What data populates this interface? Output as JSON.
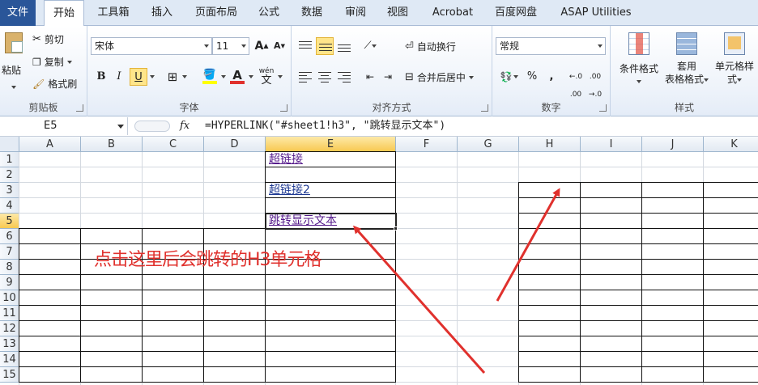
{
  "tabs": [
    "文件",
    "开始",
    "工具箱",
    "插入",
    "页面布局",
    "公式",
    "数据",
    "审阅",
    "视图",
    "Acrobat",
    "百度网盘",
    "ASAP Utilities"
  ],
  "clipboard": {
    "paste": "粘贴",
    "cut": "剪切",
    "copy": "复制",
    "format_painter": "格式刷",
    "label": "剪贴板"
  },
  "font": {
    "name": "宋体",
    "size": "11",
    "grow": "A",
    "shrink": "A",
    "wen": "wén",
    "bold": "B",
    "italic": "I",
    "underline": "U",
    "color_letter": "A",
    "label": "字体"
  },
  "alignment": {
    "wrap": "自动换行",
    "merge": "合并后居中",
    "label": "对齐方式"
  },
  "number": {
    "format": "常规",
    "percent": "%",
    "comma": ",",
    "label": "数字"
  },
  "styles": {
    "conditional": "条件格式",
    "table1": "套用",
    "table2": "表格格式",
    "cell1": "单元格样",
    "cell2": "式",
    "label": "样式"
  },
  "formula_bar": {
    "name_box": "E5",
    "fx": "fx",
    "formula": "=HYPERLINK(\"#sheet1!h3\", \"跳转显示文本\")"
  },
  "grid": {
    "columns": [
      "A",
      "B",
      "C",
      "D",
      "E",
      "F",
      "G",
      "H",
      "I",
      "J",
      "K"
    ],
    "rows": [
      "1",
      "2",
      "3",
      "4",
      "5",
      "6",
      "7",
      "8",
      "9",
      "10",
      "11",
      "12",
      "13",
      "14",
      "15"
    ],
    "selected_column": "E",
    "selected_row": "5",
    "cells": {
      "E1": "超链接",
      "E3": "超链接2",
      "E5": "跳转显示文本"
    }
  },
  "annotation": "点击这里后会跳转的H3单元格",
  "colors": {
    "accent": "#2a5699",
    "annotation": "#e0312d",
    "link": "#551a8b"
  }
}
